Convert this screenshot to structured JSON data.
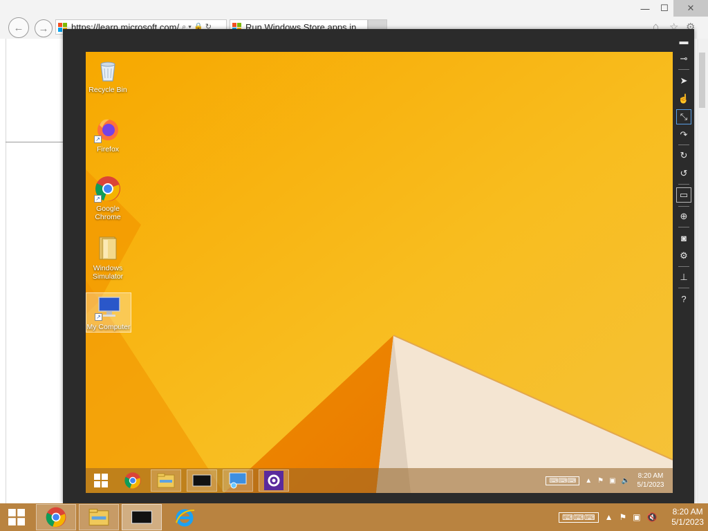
{
  "browser": {
    "address_url": "https://learn.microsoft.com/",
    "tab_title": "Run Windows Store apps in",
    "window_controls": {
      "minimize": "—",
      "maximize": "☐",
      "close": "✕"
    },
    "nav_icons": {
      "back": "back-arrow-icon",
      "forward": "forward-arrow-icon"
    }
  },
  "simulator": {
    "toolbar": [
      {
        "name": "minimize-always-on-top",
        "glyph": "▬"
      },
      {
        "name": "pin",
        "glyph": "⊸"
      },
      {
        "name": "mouse-mode",
        "glyph": "➤"
      },
      {
        "name": "touch-mode",
        "glyph": "☝"
      },
      {
        "name": "pinch-zoom",
        "glyph": "⤡"
      },
      {
        "name": "rotation-touch",
        "glyph": "↷"
      },
      {
        "name": "rotate-clockwise",
        "glyph": "↻"
      },
      {
        "name": "rotate-counterclockwise",
        "glyph": "↺"
      },
      {
        "name": "change-resolution",
        "glyph": "▭"
      },
      {
        "name": "set-location",
        "glyph": "⊕"
      },
      {
        "name": "copy-screenshot",
        "glyph": "◙"
      },
      {
        "name": "screenshot-settings",
        "glyph": "⚙"
      },
      {
        "name": "network-properties",
        "glyph": "⊥"
      },
      {
        "name": "help",
        "glyph": "?"
      }
    ],
    "desktop_icons": [
      {
        "label": "Recycle Bin",
        "icon": "recycle-bin-icon"
      },
      {
        "label": "Firefox",
        "icon": "firefox-icon"
      },
      {
        "label": "Google Chrome",
        "icon": "chrome-icon"
      },
      {
        "label": "Windows Simulator",
        "icon": "folder-icon"
      },
      {
        "label": "My Computer",
        "icon": "computer-icon"
      }
    ],
    "taskbar": {
      "clock_time": "8:20 AM",
      "clock_date": "5/1/2023"
    }
  },
  "host_taskbar": {
    "clock_time": "8:20 AM",
    "clock_date": "5/1/2023"
  },
  "colors": {
    "wallpaper_accent": "#f8b500",
    "host_taskbar": "#b98340",
    "simulator_frame": "#2b2b2b"
  }
}
